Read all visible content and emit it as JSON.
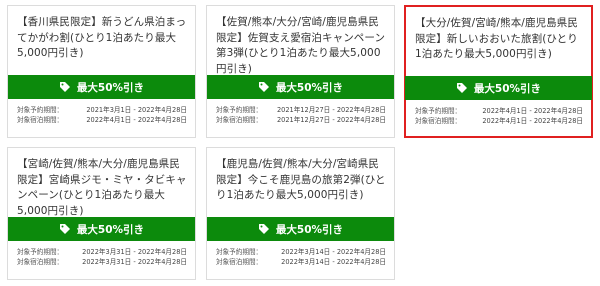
{
  "campaigns": [
    {
      "title": "【香川県民限定】新うどん県泊まってかがわ割(ひとり1泊あたり最大5,000円引き)",
      "discount": "最大50%引き",
      "booking_label": "対象予約期間：",
      "booking_period": "2021年3月1日 - 2022年4月28日",
      "stay_label": "対象宿泊期間：",
      "stay_period": "2022年4月1日 - 2022年4月28日",
      "selected": false
    },
    {
      "title": "【佐賀/熊本/大分/宮崎/鹿児島県民限定】佐賀支え愛宿泊キャンペーン第3弾(ひとり1泊あたり最大5,000円引き)",
      "discount": "最大50%引き",
      "booking_label": "対象予約期間：",
      "booking_period": "2021年12月27日 - 2022年4月28日",
      "stay_label": "対象宿泊期間：",
      "stay_period": "2021年12月27日 - 2022年4月28日",
      "selected": false
    },
    {
      "title": "【大分/佐賀/宮崎/熊本/鹿児島県民限定】新しいおおいた旅割(ひとり1泊あたり最大5,000円引き)",
      "discount": "最大50%引き",
      "booking_label": "対象予約期間：",
      "booking_period": "2022年4月1日 - 2022年4月28日",
      "stay_label": "対象宿泊期間：",
      "stay_period": "2022年4月1日 - 2022年4月28日",
      "selected": true
    },
    {
      "title": "【宮崎/佐賀/熊本/大分/鹿児島県民限定】宮崎県ジモ・ミヤ・タビキャンペーン(ひとり1泊あたり最大5,000円引き)",
      "discount": "最大50%引き",
      "booking_label": "対象予約期間：",
      "booking_period": "2022年3月31日 - 2022年4月28日",
      "stay_label": "対象宿泊期間：",
      "stay_period": "2022年3月31日 - 2022年4月28日",
      "selected": false
    },
    {
      "title": "【鹿児島/佐賀/熊本/大分/宮崎県民限定】今こそ鹿児島の旅第2弾(ひとり1泊あたり最大5,000円引き)",
      "discount": "最大50%引き",
      "booking_label": "対象予約期間：",
      "booking_period": "2022年3月14日 - 2022年4月28日",
      "stay_label": "対象宿泊期間：",
      "stay_period": "2022年3月14日 - 2022年4月28日",
      "selected": false
    }
  ],
  "colors": {
    "discount_bar": "#0c8a0c",
    "selected_border": "#e02020"
  },
  "icon": "tag-icon"
}
